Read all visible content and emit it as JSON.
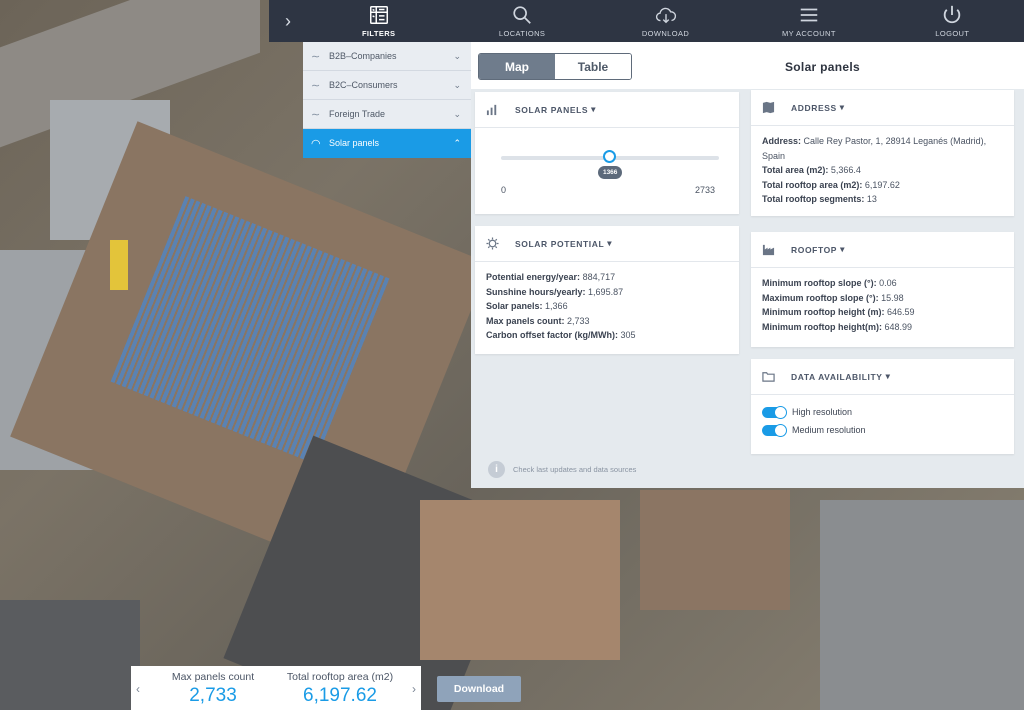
{
  "nav": {
    "items": [
      {
        "label": "FILTERS",
        "icon": "filters-icon"
      },
      {
        "label": "LOCATIONS",
        "icon": "search-icon"
      },
      {
        "label": "DOWNLOAD",
        "icon": "cloud-download-icon"
      },
      {
        "label": "MY ACCOUNT",
        "icon": "menu-icon"
      },
      {
        "label": "LOGOUT",
        "icon": "power-icon"
      }
    ],
    "active": "FILTERS"
  },
  "filters": [
    {
      "label": "B2B–Companies",
      "state": "collapsed"
    },
    {
      "label": "B2C–Consumers",
      "state": "collapsed"
    },
    {
      "label": "Foreign Trade",
      "state": "collapsed"
    },
    {
      "label": "Solar panels",
      "state": "expanded"
    }
  ],
  "view_toggle": {
    "map": "Map",
    "table": "Table",
    "selected": "Map"
  },
  "panel_title": "Solar panels",
  "solar_panels": {
    "title": "SOLAR PANELS",
    "slider_value": "1366",
    "value": 1366,
    "min": "0",
    "max": "2733",
    "max_value": 2733
  },
  "solar_potential": {
    "title": "SOLAR POTENTIAL",
    "rows": [
      {
        "label": "Potential energy/year:",
        "value": "884,717"
      },
      {
        "label": "Sunshine hours/yearly:",
        "value": "1,695.87"
      },
      {
        "label": "Solar panels:",
        "value": "1,366"
      },
      {
        "label": "Max panels count:",
        "value": "2,733"
      },
      {
        "label": "Carbon offset factor (kg/MWh):",
        "value": "305"
      }
    ]
  },
  "address": {
    "title": "ADDRESS",
    "rows": [
      {
        "label": "Address:",
        "value": "Calle Rey Pastor, 1, 28914 Leganés (Madrid), Spain"
      },
      {
        "label": "Total area (m2):",
        "value": "5,366.4"
      },
      {
        "label": "Total rooftop area (m2):",
        "value": "6,197.62"
      },
      {
        "label": "Total rooftop segments:",
        "value": "13"
      }
    ]
  },
  "rooftop": {
    "title": "ROOFTOP",
    "rows": [
      {
        "label": "Minimum rooftop slope (°):",
        "value": "0.06"
      },
      {
        "label": "Maximum rooftop slope (°):",
        "value": "15.98"
      },
      {
        "label": "Minimum rooftop height (m):",
        "value": "646.59"
      },
      {
        "label": "Minimum rooftop height(m):",
        "value": "648.99"
      }
    ]
  },
  "data_availability": {
    "title": "DATA AVAILABILITY",
    "toggles": [
      {
        "label": "High resolution",
        "on": true
      },
      {
        "label": "Medium resolution",
        "on": true
      }
    ]
  },
  "hint": "Check last updates and data sources",
  "stats": {
    "left": {
      "label": "Max panels count",
      "value": "2,733"
    },
    "right": {
      "label": "Total rooftop area (m2)",
      "value": "6,197.62"
    }
  },
  "download_label": "Download",
  "colors": {
    "accent": "#1a9be6",
    "nav_bg": "#2e3543",
    "panel_bg": "#e5eaee"
  }
}
